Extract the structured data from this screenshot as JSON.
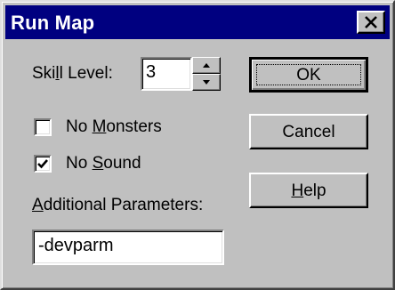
{
  "window": {
    "title": "Run Map",
    "close_symbol": "✕"
  },
  "skill": {
    "label_pre": "Ski",
    "label_ul": "l",
    "label_post": "l Level:",
    "value": "3"
  },
  "no_monsters": {
    "label_pre": "No ",
    "label_ul": "M",
    "label_post": "onsters",
    "checked": false
  },
  "no_sound": {
    "label_pre": "No ",
    "label_ul": "S",
    "label_post": "ound",
    "checked": true
  },
  "params": {
    "label_ul": "A",
    "label_post": "dditional Parameters:",
    "value": "-devparm"
  },
  "buttons": {
    "ok": "OK",
    "cancel": "Cancel",
    "help_ul": "H",
    "help_post": "elp"
  },
  "colors": {
    "face": "#c0c0c0",
    "title_bar": "#000080",
    "title_text": "#ffffff"
  }
}
